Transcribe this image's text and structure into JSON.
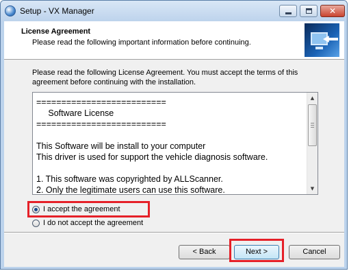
{
  "window": {
    "title": "Setup - VX Manager",
    "controls": {
      "minimize": "minimize",
      "maximize": "maximize",
      "close": "✕"
    }
  },
  "header": {
    "title": "License Agreement",
    "subtitle": "Please read the following important information before continuing."
  },
  "intro": "Please read the following License Agreement. You must accept the terms of this agreement before continuing with the installation.",
  "license": {
    "lines": [
      "==========================",
      "     Software License",
      "==========================",
      "",
      "This Software will be install to your computer",
      "This driver is used for support the vehicle diagnosis software.",
      "",
      "1. This software was copyrighted by ALLScanner.",
      "2. Only the legitimate users can use this software."
    ]
  },
  "options": {
    "accept": "I accept the agreement",
    "decline": "I do not accept the agreement",
    "selected": "accept"
  },
  "buttons": {
    "back": "< Back",
    "next": "Next >",
    "cancel": "Cancel"
  },
  "colors": {
    "highlight": "#e52028",
    "titlebar": "#bdd3ec",
    "dialog": "#f0f0f0"
  }
}
